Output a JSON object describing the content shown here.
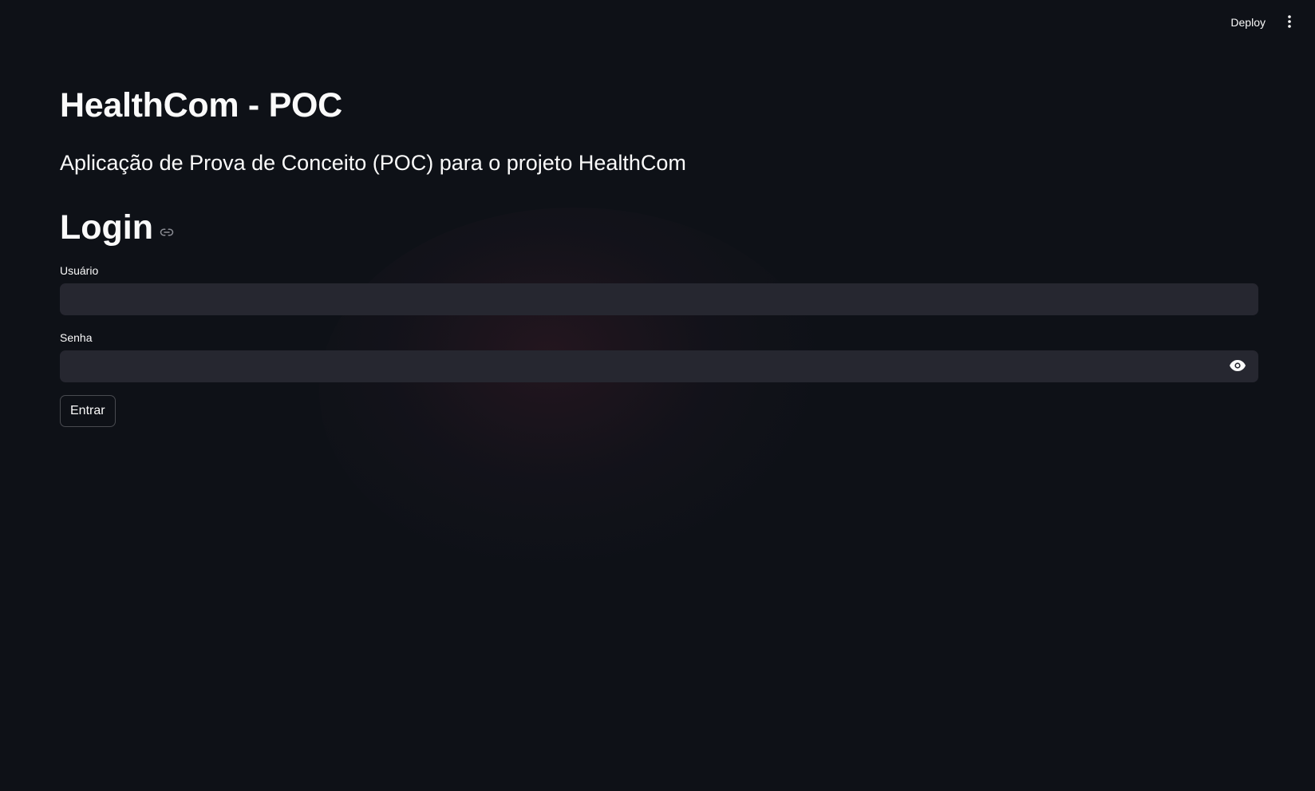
{
  "header": {
    "deploy_label": "Deploy",
    "menu_icon": "vertical-ellipsis-icon"
  },
  "main": {
    "title": "HealthCom - POC",
    "subtitle": "Aplicação de Prova de Conceito (POC) para o projeto HealthCom",
    "login_heading": "Login",
    "anchor_icon": "link-icon"
  },
  "form": {
    "username": {
      "label": "Usuário",
      "value": "",
      "placeholder": ""
    },
    "password": {
      "label": "Senha",
      "value": "",
      "placeholder": "",
      "toggle_icon": "eye-icon"
    },
    "submit_label": "Entrar"
  },
  "colors": {
    "background": "#0e1117",
    "input_background": "#262730",
    "text": "#fafafa"
  }
}
